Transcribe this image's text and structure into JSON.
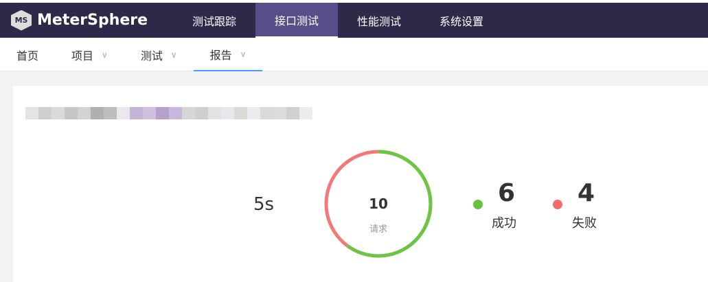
{
  "header": {
    "brand": "MeterSphere",
    "logo_text": "MS",
    "tabs": [
      {
        "label": "测试跟踪"
      },
      {
        "label": "接口测试",
        "active": true
      },
      {
        "label": "性能测试"
      },
      {
        "label": "系统设置"
      }
    ]
  },
  "subnav": {
    "items": [
      {
        "label": "首页"
      },
      {
        "label": "项目"
      },
      {
        "label": "测试"
      },
      {
        "label": "报告",
        "active": true
      }
    ]
  },
  "report": {
    "duration": "5s",
    "total": "10",
    "total_label": "请求",
    "success": "6",
    "success_label": "成功",
    "fail": "4",
    "fail_label": "失败"
  },
  "colors": {
    "success": "#67c23a",
    "fail": "#f56c6c",
    "header": "#2c2a48",
    "active_tab": "#574f8a",
    "accent": "#409eff"
  }
}
